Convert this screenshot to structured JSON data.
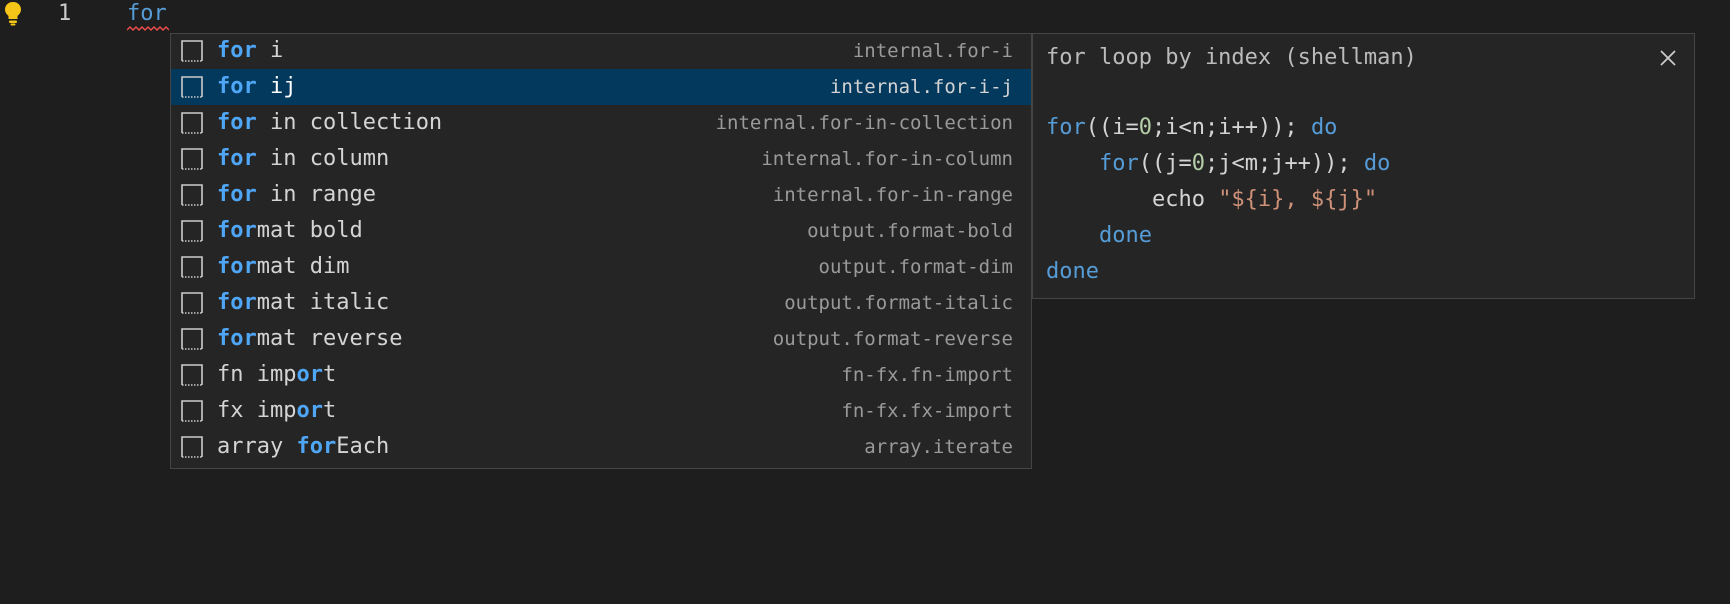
{
  "editor": {
    "line_number": "1",
    "code_text": "for"
  },
  "suggestions": [
    {
      "segments": [
        {
          "t": "for",
          "hl": true
        },
        {
          "t": " i",
          "hl": false
        }
      ],
      "detail": "internal.for-i",
      "selected": false
    },
    {
      "segments": [
        {
          "t": "for",
          "hl": true
        },
        {
          "t": " ij",
          "hl": false
        }
      ],
      "detail": "internal.for-i-j",
      "selected": true
    },
    {
      "segments": [
        {
          "t": "for",
          "hl": true
        },
        {
          "t": " in collection",
          "hl": false
        }
      ],
      "detail": "internal.for-in-collection",
      "selected": false
    },
    {
      "segments": [
        {
          "t": "for",
          "hl": true
        },
        {
          "t": " in column",
          "hl": false
        }
      ],
      "detail": "internal.for-in-column",
      "selected": false
    },
    {
      "segments": [
        {
          "t": "for",
          "hl": true
        },
        {
          "t": " in range",
          "hl": false
        }
      ],
      "detail": "internal.for-in-range",
      "selected": false
    },
    {
      "segments": [
        {
          "t": "for",
          "hl": true
        },
        {
          "t": "mat bold",
          "hl": false
        }
      ],
      "detail": "output.format-bold",
      "selected": false
    },
    {
      "segments": [
        {
          "t": "for",
          "hl": true
        },
        {
          "t": "mat dim",
          "hl": false
        }
      ],
      "detail": "output.format-dim",
      "selected": false
    },
    {
      "segments": [
        {
          "t": "for",
          "hl": true
        },
        {
          "t": "mat italic",
          "hl": false
        }
      ],
      "detail": "output.format-italic",
      "selected": false
    },
    {
      "segments": [
        {
          "t": "for",
          "hl": true
        },
        {
          "t": "mat reverse",
          "hl": false
        }
      ],
      "detail": "output.format-reverse",
      "selected": false
    },
    {
      "segments": [
        {
          "t": "fn imp",
          "hl": false
        },
        {
          "t": "or",
          "hl": true
        },
        {
          "t": "t",
          "hl": false
        }
      ],
      "detail": "fn-fx.fn-import",
      "selected": false
    },
    {
      "segments": [
        {
          "t": "fx imp",
          "hl": false
        },
        {
          "t": "or",
          "hl": true
        },
        {
          "t": "t",
          "hl": false
        }
      ],
      "detail": "fn-fx.fx-import",
      "selected": false
    },
    {
      "segments": [
        {
          "t": "array ",
          "hl": false
        },
        {
          "t": "for",
          "hl": true
        },
        {
          "t": "Each",
          "hl": false
        }
      ],
      "detail": "array.iterate",
      "selected": false
    }
  ],
  "details": {
    "title": "for loop by index (shellman)",
    "close_icon": "close-icon",
    "code_lines": [
      [
        {
          "t": "for",
          "c": "kw"
        },
        {
          "t": "((i=",
          "c": ""
        },
        {
          "t": "0",
          "c": "num"
        },
        {
          "t": ";i<n;i++)); ",
          "c": ""
        },
        {
          "t": "do",
          "c": "kw"
        }
      ],
      [
        {
          "t": "    ",
          "c": ""
        },
        {
          "t": "for",
          "c": "kw"
        },
        {
          "t": "((j=",
          "c": ""
        },
        {
          "t": "0",
          "c": "num"
        },
        {
          "t": ";j<m;j++)); ",
          "c": ""
        },
        {
          "t": "do",
          "c": "kw"
        }
      ],
      [
        {
          "t": "        echo ",
          "c": ""
        },
        {
          "t": "\"${i}, ${j}\"",
          "c": "str"
        }
      ],
      [
        {
          "t": "    ",
          "c": ""
        },
        {
          "t": "done",
          "c": "kw"
        }
      ],
      [
        {
          "t": "done",
          "c": "kw"
        }
      ]
    ]
  },
  "colors": {
    "background": "#1e1e1e",
    "selected_row": "#04395e",
    "highlight": "#4fa6f5",
    "keyword": "#569cd6",
    "string": "#ce9178",
    "number": "#b5cea8",
    "lightbulb": "#f5c518",
    "squiggle": "#f14c4c"
  }
}
